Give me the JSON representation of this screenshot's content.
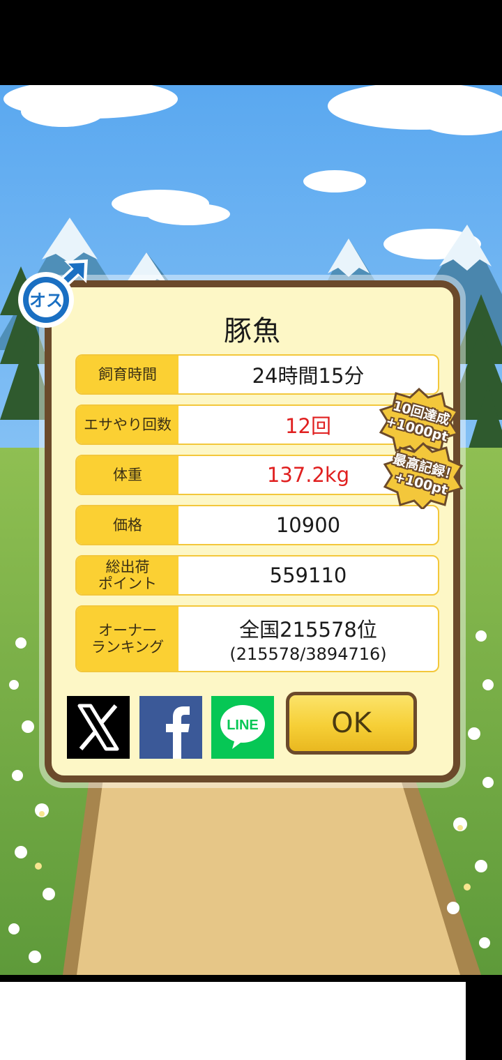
{
  "dialog": {
    "title": "豚魚",
    "rows": [
      {
        "label": "飼育時間",
        "value": "24時間15分",
        "highlight": false
      },
      {
        "label": "エサやり回数",
        "value": "12回",
        "highlight": true
      },
      {
        "label": "体重",
        "value": "137.2kg",
        "highlight": true
      },
      {
        "label": "価格",
        "value": "10900",
        "highlight": false
      },
      {
        "label_line1": "総出荷",
        "label_line2": "ポイント",
        "value": "559110",
        "highlight": false
      },
      {
        "label_line1": "オーナー",
        "label_line2": "ランキング",
        "value": "全国215578位",
        "value_sub": "(215578/3894716)",
        "highlight": false
      }
    ],
    "share": {
      "x": "X",
      "facebook": "f",
      "line": "LINE"
    },
    "ok_label": "OK"
  },
  "badges": [
    {
      "line1": "10回達成",
      "line2": "+1000pt"
    },
    {
      "line1": "最高記録！",
      "line2": "+100pt"
    }
  ],
  "gender_icon": {
    "label": "オス",
    "icon": "male-symbol-icon"
  },
  "colors": {
    "accent": "#fbd033",
    "frame": "#6b4a2b",
    "panel": "#fdf7c6",
    "highlight_text": "#e02020"
  }
}
